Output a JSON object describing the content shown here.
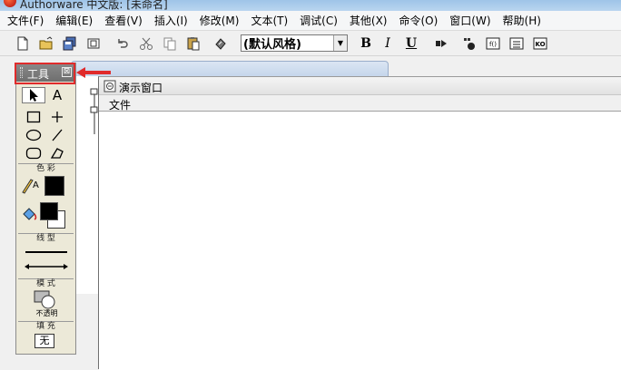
{
  "window": {
    "title": "Authorware 中文版: [未命名]"
  },
  "menubar": {
    "items": [
      "文件(F)",
      "编辑(E)",
      "查看(V)",
      "插入(I)",
      "修改(M)",
      "文本(T)",
      "调试(C)",
      "其他(X)",
      "命令(O)",
      "窗口(W)",
      "帮助(H)"
    ]
  },
  "toolbar": {
    "style_combo_value": "(默认风格)",
    "bold_label": "B",
    "italic_label": "I",
    "underline_label": "U"
  },
  "tools_panel": {
    "title": "工具",
    "close_glyph": "⊠",
    "text_tool_label": "A",
    "color_section": "色 彩",
    "pen_color_label": "A",
    "line_section": "线 型",
    "mode_section": "模 式",
    "mode_value": "不透明",
    "fill_section": "填 充",
    "fill_value": "无"
  },
  "presentation_window": {
    "title": "演示窗口",
    "menu_file": "文件"
  },
  "colors": {
    "highlight": "#e02b2b",
    "pen_color": "#000000",
    "fill_color": "#000000"
  }
}
